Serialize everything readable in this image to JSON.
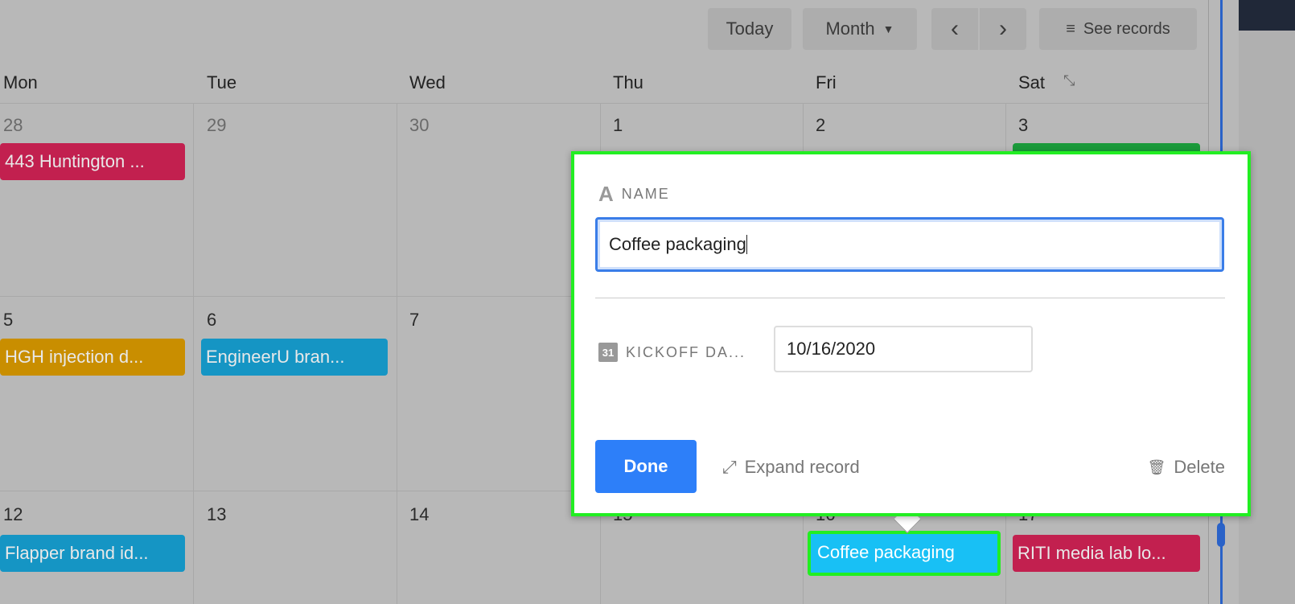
{
  "toolbar": {
    "today": "Today",
    "view": "Month",
    "prev": "‹",
    "next": "›",
    "see_records": "See records"
  },
  "days": [
    "Mon",
    "Tue",
    "Wed",
    "Thu",
    "Fri",
    "Sat"
  ],
  "weeks": [
    {
      "dates": [
        "28",
        "29",
        "30",
        "1",
        "2",
        "3"
      ]
    },
    {
      "dates": [
        "5",
        "6",
        "7",
        "",
        "",
        ""
      ]
    },
    {
      "dates": [
        "12",
        "13",
        "14",
        "15",
        "16",
        "17"
      ]
    }
  ],
  "events": [
    {
      "label": "443 Huntington ...",
      "color": "#c2204f"
    },
    {
      "label": "",
      "color": "#1a9a3a"
    },
    {
      "label": "HGH injection d...",
      "color": "#c98e00"
    },
    {
      "label": "EngineerU bran...",
      "color": "#1595c4"
    },
    {
      "label": "Flapper brand id...",
      "color": "#1595c4"
    },
    {
      "label": "Coffee packaging",
      "color": "#18c0f5"
    },
    {
      "label": "RITI media lab lo...",
      "color": "#c2204f"
    }
  ],
  "popup": {
    "name_label": "NAME",
    "name_value": "Coffee packaging",
    "date_label": "KICKOFF DA...",
    "date_value": "10/16/2020",
    "done": "Done",
    "expand": "Expand record",
    "delete": "Delete"
  }
}
